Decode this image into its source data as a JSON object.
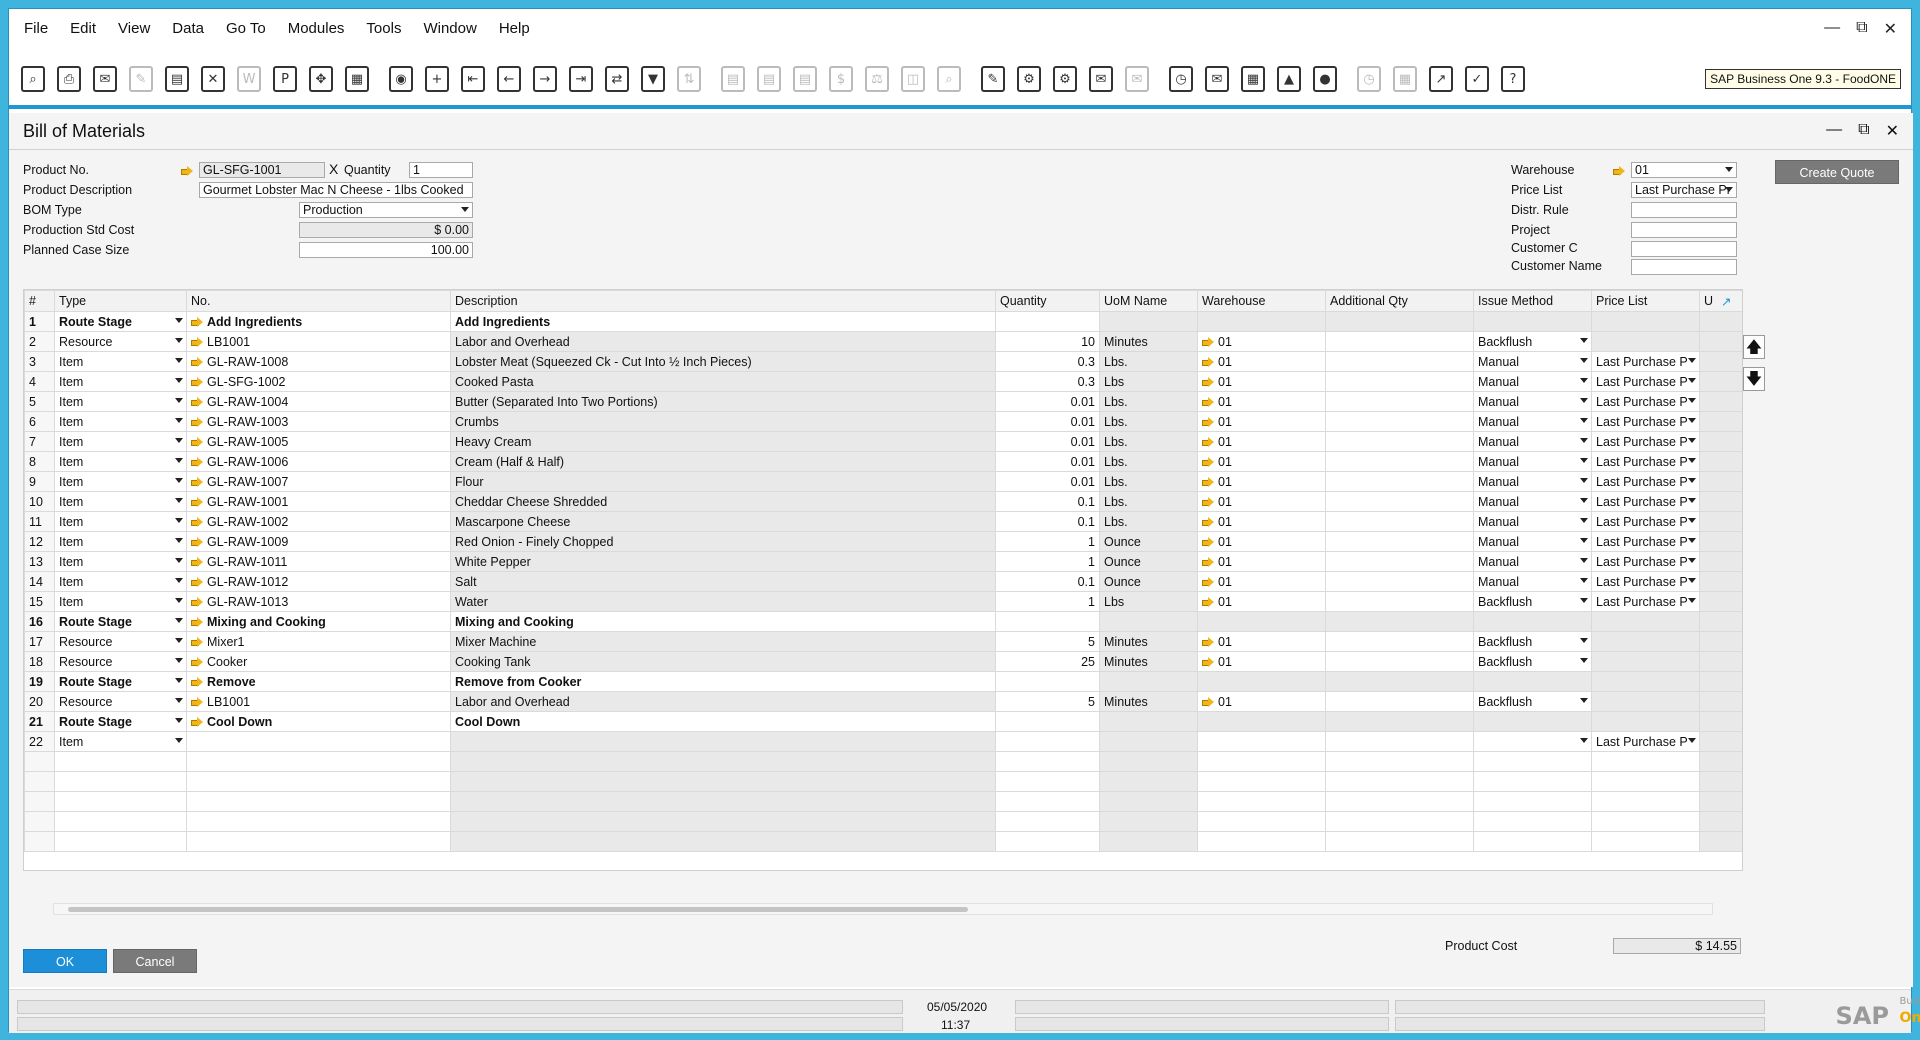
{
  "menu": {
    "items": [
      "File",
      "Edit",
      "View",
      "Data",
      "Go To",
      "Modules",
      "Tools",
      "Window",
      "Help"
    ]
  },
  "version_badge": "SAP Business One 9.3 - FoodONE",
  "form": {
    "title": "Bill of Materials",
    "product_no_label": "Product No.",
    "product_no": "GL-SFG-1001",
    "x_label": "X",
    "quantity_label": "Quantity",
    "quantity": "1",
    "product_desc_label": "Product Description",
    "product_desc": "Gourmet Lobster Mac N Cheese - 1lbs Cooked",
    "bom_type_label": "BOM Type",
    "bom_type": "Production",
    "prod_std_cost_label": "Production Std Cost",
    "prod_std_cost": "$ 0.00",
    "planned_case_label": "Planned Case Size",
    "planned_case": "100.00",
    "warehouse_label": "Warehouse",
    "warehouse": "01",
    "price_list_label": "Price List",
    "price_list": "Last Purchase Pr",
    "distr_rule_label": "Distr. Rule",
    "project_label": "Project",
    "customer_code_label": "Customer C",
    "customer_name_label": "Customer Name",
    "create_quote": "Create Quote",
    "product_cost_label": "Product Cost",
    "product_cost": "$ 14.55",
    "ok": "OK",
    "cancel": "Cancel"
  },
  "grid": {
    "columns": [
      "#",
      "Type",
      "No.",
      "Description",
      "Quantity",
      "UoM Name",
      "Warehouse",
      "Additional Qty",
      "Issue Method",
      "Price List",
      "U"
    ],
    "rows": [
      {
        "n": "1",
        "type": "Route Stage",
        "no": "Add Ingredients",
        "desc": "Add Ingredients",
        "qty": "",
        "uom": "",
        "wh": "",
        "issue": "",
        "price": "",
        "stage": true
      },
      {
        "n": "2",
        "type": "Resource",
        "no": "LB1001",
        "desc": "Labor and Overhead",
        "qty": "10",
        "uom": "Minutes",
        "wh": "01",
        "issue": "Backflush",
        "price": ""
      },
      {
        "n": "3",
        "type": "Item",
        "no": "GL-RAW-1008",
        "desc": "Lobster Meat (Squeezed Ck - Cut Into ½ Inch Pieces)",
        "qty": "0.3",
        "uom": "Lbs.",
        "wh": "01",
        "issue": "Manual",
        "price": "Last Purchase P"
      },
      {
        "n": "4",
        "type": "Item",
        "no": "GL-SFG-1002",
        "desc": "Cooked Pasta",
        "qty": "0.3",
        "uom": "Lbs",
        "wh": "01",
        "issue": "Manual",
        "price": "Last Purchase P"
      },
      {
        "n": "5",
        "type": "Item",
        "no": "GL-RAW-1004",
        "desc": "Butter (Separated Into Two Portions)",
        "qty": "0.01",
        "uom": "Lbs.",
        "wh": "01",
        "issue": "Manual",
        "price": "Last Purchase P"
      },
      {
        "n": "6",
        "type": "Item",
        "no": "GL-RAW-1003",
        "desc": "Crumbs",
        "qty": "0.01",
        "uom": "Lbs.",
        "wh": "01",
        "issue": "Manual",
        "price": "Last Purchase P"
      },
      {
        "n": "7",
        "type": "Item",
        "no": "GL-RAW-1005",
        "desc": "Heavy Cream",
        "qty": "0.01",
        "uom": "Lbs.",
        "wh": "01",
        "issue": "Manual",
        "price": "Last Purchase P"
      },
      {
        "n": "8",
        "type": "Item",
        "no": "GL-RAW-1006",
        "desc": "Cream (Half & Half)",
        "qty": "0.01",
        "uom": "Lbs.",
        "wh": "01",
        "issue": "Manual",
        "price": "Last Purchase P"
      },
      {
        "n": "9",
        "type": "Item",
        "no": "GL-RAW-1007",
        "desc": "Flour",
        "qty": "0.01",
        "uom": "Lbs.",
        "wh": "01",
        "issue": "Manual",
        "price": "Last Purchase P"
      },
      {
        "n": "10",
        "type": "Item",
        "no": "GL-RAW-1001",
        "desc": "Cheddar Cheese Shredded",
        "qty": "0.1",
        "uom": "Lbs.",
        "wh": "01",
        "issue": "Manual",
        "price": "Last Purchase P"
      },
      {
        "n": "11",
        "type": "Item",
        "no": "GL-RAW-1002",
        "desc": "Mascarpone Cheese",
        "qty": "0.1",
        "uom": "Lbs.",
        "wh": "01",
        "issue": "Manual",
        "price": "Last Purchase P"
      },
      {
        "n": "12",
        "type": "Item",
        "no": "GL-RAW-1009",
        "desc": "Red Onion - Finely Chopped",
        "qty": "1",
        "uom": "Ounce",
        "wh": "01",
        "issue": "Manual",
        "price": "Last Purchase P"
      },
      {
        "n": "13",
        "type": "Item",
        "no": "GL-RAW-1011",
        "desc": "White Pepper",
        "qty": "1",
        "uom": "Ounce",
        "wh": "01",
        "issue": "Manual",
        "price": "Last Purchase P"
      },
      {
        "n": "14",
        "type": "Item",
        "no": "GL-RAW-1012",
        "desc": "Salt",
        "qty": "0.1",
        "uom": "Ounce",
        "wh": "01",
        "issue": "Manual",
        "price": "Last Purchase P"
      },
      {
        "n": "15",
        "type": "Item",
        "no": "GL-RAW-1013",
        "desc": "Water",
        "qty": "1",
        "uom": "Lbs",
        "wh": "01",
        "issue": "Backflush",
        "price": "Last Purchase P"
      },
      {
        "n": "16",
        "type": "Route Stage",
        "no": "Mixing and Cooking",
        "desc": "Mixing and Cooking",
        "qty": "",
        "uom": "",
        "wh": "",
        "issue": "",
        "price": "",
        "stage": true
      },
      {
        "n": "17",
        "type": "Resource",
        "no": "Mixer1",
        "desc": "Mixer Machine",
        "qty": "5",
        "uom": "Minutes",
        "wh": "01",
        "issue": "Backflush",
        "price": ""
      },
      {
        "n": "18",
        "type": "Resource",
        "no": "Cooker",
        "desc": "Cooking Tank",
        "qty": "25",
        "uom": "Minutes",
        "wh": "01",
        "issue": "Backflush",
        "price": ""
      },
      {
        "n": "19",
        "type": "Route Stage",
        "no": "Remove",
        "desc": "Remove from Cooker",
        "qty": "",
        "uom": "",
        "wh": "",
        "issue": "",
        "price": "",
        "stage": true
      },
      {
        "n": "20",
        "type": "Resource",
        "no": "LB1001",
        "desc": "Labor and Overhead",
        "qty": "5",
        "uom": "Minutes",
        "wh": "01",
        "issue": "Backflush",
        "price": ""
      },
      {
        "n": "21",
        "type": "Route Stage",
        "no": "Cool Down",
        "desc": "Cool Down",
        "qty": "",
        "uom": "",
        "wh": "",
        "issue": "",
        "price": "",
        "stage": true
      },
      {
        "n": "22",
        "type": "Item",
        "no": "",
        "desc": "",
        "qty": "",
        "uom": "",
        "wh": "",
        "issue": "",
        "price": "Last Purchase P",
        "newrow": true
      }
    ]
  },
  "status": {
    "date": "05/05/2020",
    "time": "11:37"
  },
  "logo": {
    "sap": "SAP",
    "business": "Business",
    "one": "One"
  }
}
